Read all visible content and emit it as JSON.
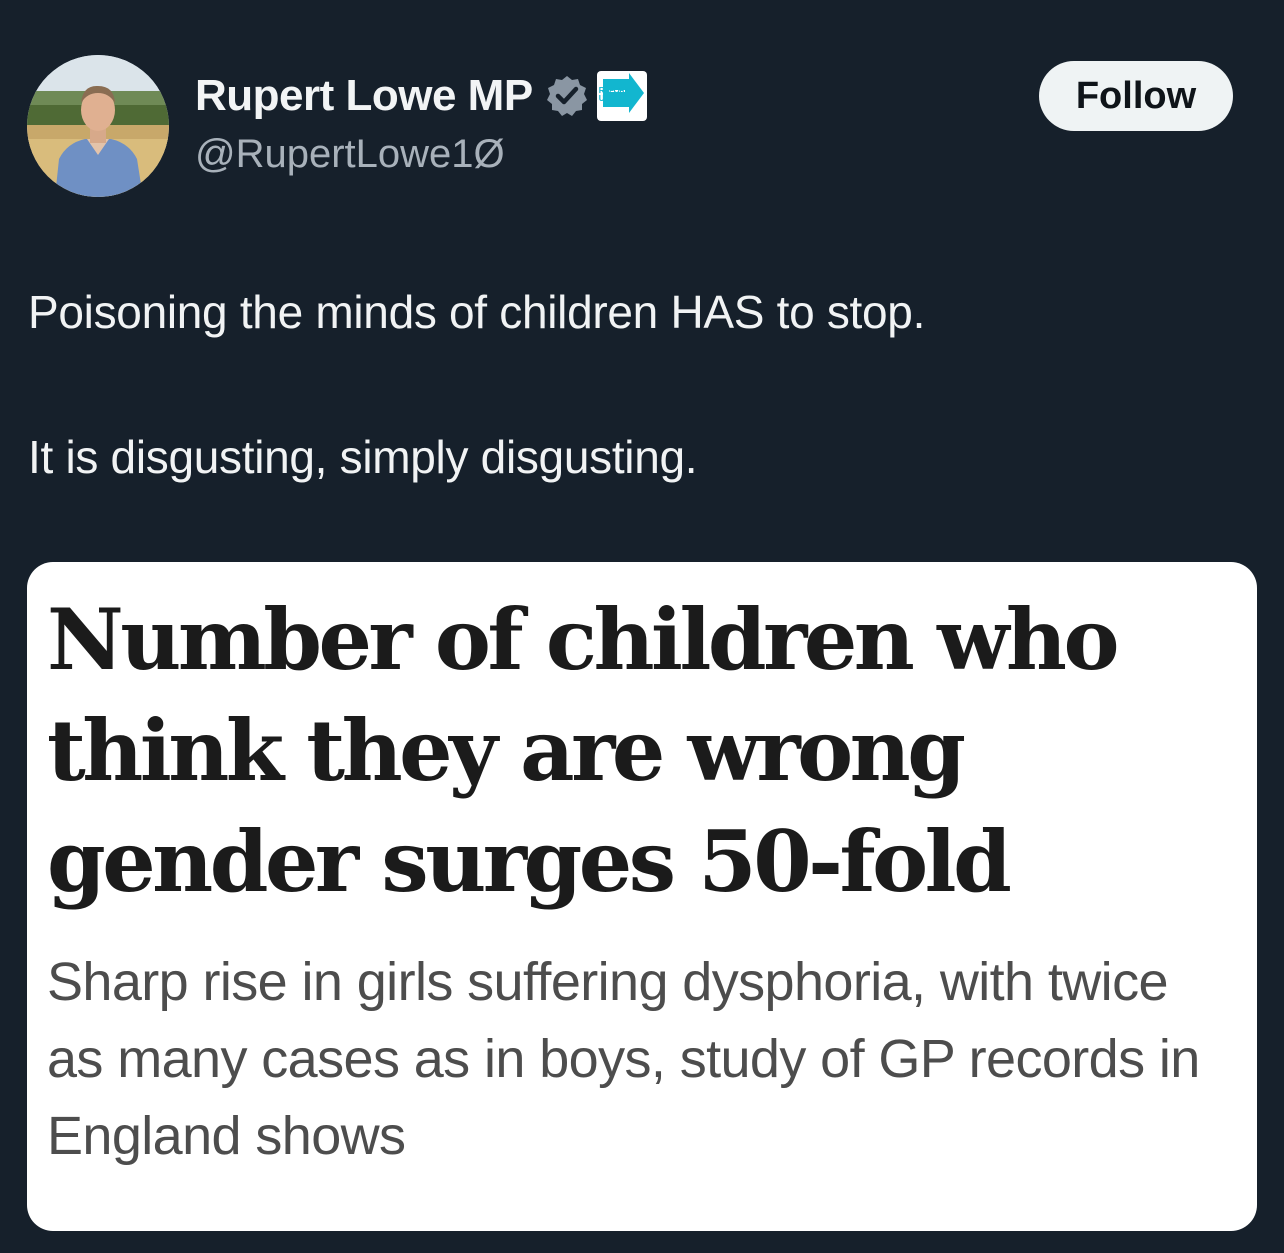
{
  "author": {
    "display_name": "Rupert Lowe MP",
    "handle": "@RupertLowe1Ø",
    "badge_text": "REFORM UK",
    "avatar_icon": "profile-photo",
    "verified_icon": "verified-badge-icon"
  },
  "follow_label": "Follow",
  "tweet": {
    "line1": "Poisoning the minds of children HAS to stop.",
    "line2": "It is disgusting, simply disgusting."
  },
  "article": {
    "headline": "Number of children who think they are wrong gender surges 50-fold",
    "standfirst": "Sharp rise in girls suffering dysphoria, with twice as many cases as in boys, study of GP records in England shows"
  },
  "colors": {
    "background": "#16202b",
    "follow_bg": "#eff3f4",
    "verified": "#8a96a3",
    "reform": "#12b6cf"
  }
}
